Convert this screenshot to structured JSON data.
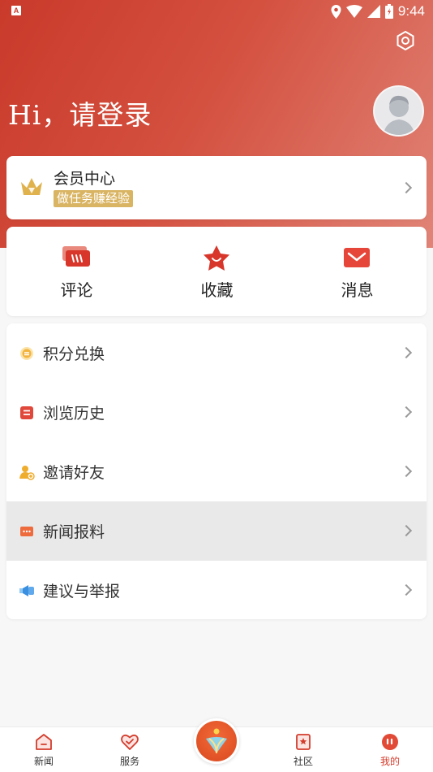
{
  "status_bar": {
    "notif_letter": "A",
    "time": "9:44",
    "icons": [
      "location-icon",
      "wifi-icon",
      "signal-icon",
      "battery-icon"
    ]
  },
  "header": {
    "greeting": "Hi，请登录",
    "settings_icon": "settings-icon",
    "avatar_icon": "default-avatar"
  },
  "vip": {
    "title": "会员中心",
    "badge": "做任务赚经验",
    "icon": "crown-icon"
  },
  "quick_actions": [
    {
      "label": "评论",
      "icon": "comment-icon"
    },
    {
      "label": "收藏",
      "icon": "star-icon"
    },
    {
      "label": "消息",
      "icon": "mail-icon"
    }
  ],
  "menu": [
    {
      "label": "积分兑换",
      "icon": "coin-icon"
    },
    {
      "label": "浏览历史",
      "icon": "history-icon"
    },
    {
      "label": "邀请好友",
      "icon": "invite-icon"
    },
    {
      "label": "新闻报料",
      "icon": "news-report-icon",
      "highlighted": true
    },
    {
      "label": "建议与举报",
      "icon": "feedback-icon"
    }
  ],
  "tabbar": {
    "tabs": [
      {
        "label": "新闻",
        "icon": "news-tab-icon"
      },
      {
        "label": "服务",
        "icon": "service-tab-icon"
      },
      {
        "label": "社区",
        "icon": "community-tab-icon"
      },
      {
        "label": "我的",
        "icon": "profile-tab-icon",
        "active": true
      }
    ],
    "center_icon": "home-logo-icon"
  },
  "colors": {
    "brand_red": "#d33c2c",
    "gold": "#d9b463"
  }
}
